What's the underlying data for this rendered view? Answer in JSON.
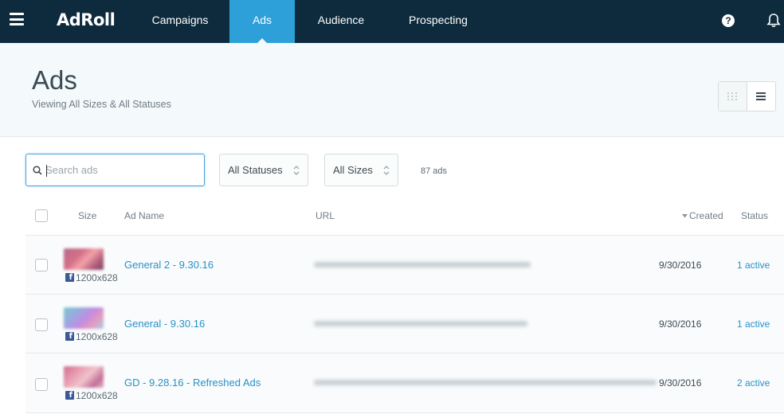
{
  "nav": {
    "logo": "AdRoll",
    "items": [
      {
        "label": "Campaigns",
        "active": false
      },
      {
        "label": "Ads",
        "active": true
      },
      {
        "label": "Audience",
        "active": false
      },
      {
        "label": "Prospecting",
        "active": false
      }
    ],
    "help_label": "?"
  },
  "header": {
    "title": "Ads",
    "subtitle": "Viewing All Sizes & All Statuses"
  },
  "filters": {
    "search_placeholder": "Search ads",
    "status_select": "All Statuses",
    "size_select": "All Sizes",
    "ad_count": "87 ads"
  },
  "table": {
    "columns": {
      "size": "Size",
      "ad_name": "Ad Name",
      "url": "URL",
      "created": "Created",
      "status": "Status"
    },
    "rows": [
      {
        "size": "1200x628",
        "name": "General 2 - 9.30.16",
        "created": "9/30/2016",
        "status": "1 active"
      },
      {
        "size": "1200x628",
        "name": "General - 9.30.16",
        "created": "9/30/2016",
        "status": "1 active"
      },
      {
        "size": "1200x628",
        "name": "GD - 9.28.16 - Refreshed Ads",
        "created": "9/30/2016",
        "status": "2 active"
      }
    ]
  },
  "colors": {
    "nav_bg": "#0e2b3e",
    "nav_active": "#2d9fd9",
    "link": "#2a91c7",
    "facebook": "#3b5998"
  }
}
